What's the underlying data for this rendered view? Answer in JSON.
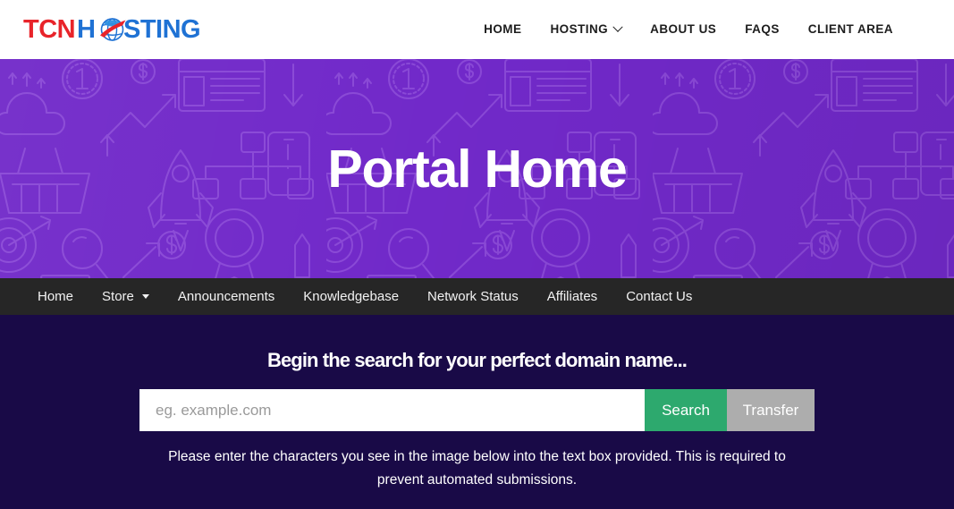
{
  "header": {
    "logo": {
      "text_primary": "TCN",
      "text_secondary_pre": "H",
      "text_secondary_post": "STING",
      "icon": "globe-icon",
      "color_primary": "#E8242A",
      "color_secondary": "#1F72D4"
    },
    "nav": [
      {
        "label": "HOME",
        "has_dropdown": false
      },
      {
        "label": "HOSTING",
        "has_dropdown": true
      },
      {
        "label": "ABOUT US",
        "has_dropdown": false
      },
      {
        "label": "FAQS",
        "has_dropdown": false
      },
      {
        "label": "CLIENT AREA",
        "has_dropdown": false
      }
    ]
  },
  "hero": {
    "title": "Portal Home",
    "background_color": "#7129C9",
    "pattern_icons": [
      "cloud-icon",
      "globe-icon",
      "monitor-icon",
      "clipboard-icon",
      "money-icon",
      "wallet-icon",
      "coin-icon",
      "dollar-icon",
      "browser-window-icon",
      "arrow-down-icon",
      "arrow-up-icon",
      "shopping-basket-icon",
      "rocket-icon",
      "sitemap-icon",
      "smartphone-icon",
      "target-icon",
      "magnifier-icon",
      "award-ribbon-icon",
      "pencil-icon",
      "growth-chart-icon"
    ]
  },
  "sub_nav": {
    "background_color": "#262626",
    "items": [
      {
        "label": "Home",
        "has_dropdown": false
      },
      {
        "label": "Store",
        "has_dropdown": true
      },
      {
        "label": "Announcements",
        "has_dropdown": false
      },
      {
        "label": "Knowledgebase",
        "has_dropdown": false
      },
      {
        "label": "Network Status",
        "has_dropdown": false
      },
      {
        "label": "Affiliates",
        "has_dropdown": false
      },
      {
        "label": "Contact Us",
        "has_dropdown": false
      }
    ]
  },
  "domain_search": {
    "background_color": "#190A47",
    "heading": "Begin the search for your perfect domain name...",
    "input_placeholder": "eg. example.com",
    "input_value": "",
    "search_button_label": "Search",
    "search_button_color": "#2DA96E",
    "transfer_button_label": "Transfer",
    "transfer_button_color": "#ADADAD",
    "captcha_note": "Please enter the characters you see in the image below into the text box provided. This is required to prevent automated submissions."
  }
}
